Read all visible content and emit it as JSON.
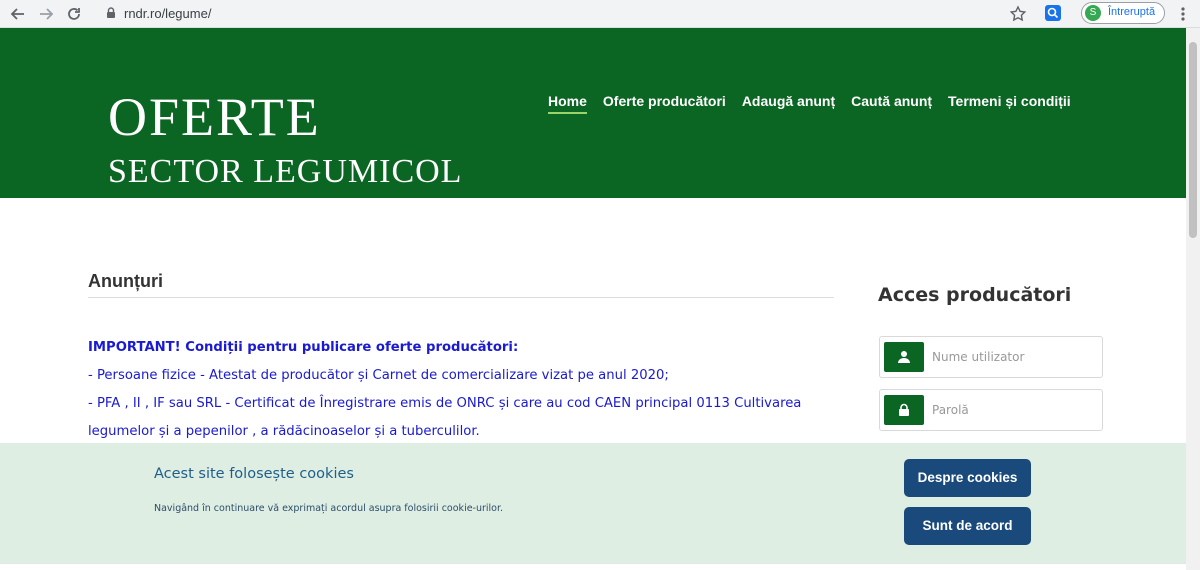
{
  "browser": {
    "url": "rndr.ro/legume/",
    "profile_initial": "S",
    "profile_label": "Întreruptă"
  },
  "header": {
    "logo_line1": "OFERTE",
    "logo_line2": "SECTOR LEGUMICOL",
    "menu": [
      {
        "label": "Home",
        "active": true
      },
      {
        "label": "Oferte producători"
      },
      {
        "label": "Adaugă anunț"
      },
      {
        "label": "Caută anunț"
      },
      {
        "label": "Termeni și condiții"
      }
    ]
  },
  "main": {
    "section_title": "Anunțuri",
    "notice": {
      "heading": "IMPORTANT! Condiții pentru publicare oferte producători:",
      "line1": "- Persoane fizice - Atestat de producător și Carnet de comercializare vizat pe anul 2020;",
      "line2": "- PFA , II , IF sau SRL - Certificat de Înregistrare emis de ONRC și care au cod CAEN principal 0113 Cultivarea legumelor și a pepenilor , a rădăcinoaselor și a tuberculilor."
    }
  },
  "sidebar": {
    "title": "Acces producători",
    "username_placeholder": "Nume utilizator",
    "password_placeholder": "Parolă"
  },
  "cookie": {
    "title": "Acest site folosește cookies",
    "text": "Navigând în continuare vă exprimați acordul asupra folosirii cookie-urilor.",
    "btn_about": "Despre cookies",
    "btn_agree": "Sunt de acord"
  },
  "colors": {
    "header_bg": "#0b6623",
    "notice_text": "#1a1ad1",
    "cookie_bg": "#dfeee2",
    "cookie_button": "#1a4a7c"
  }
}
